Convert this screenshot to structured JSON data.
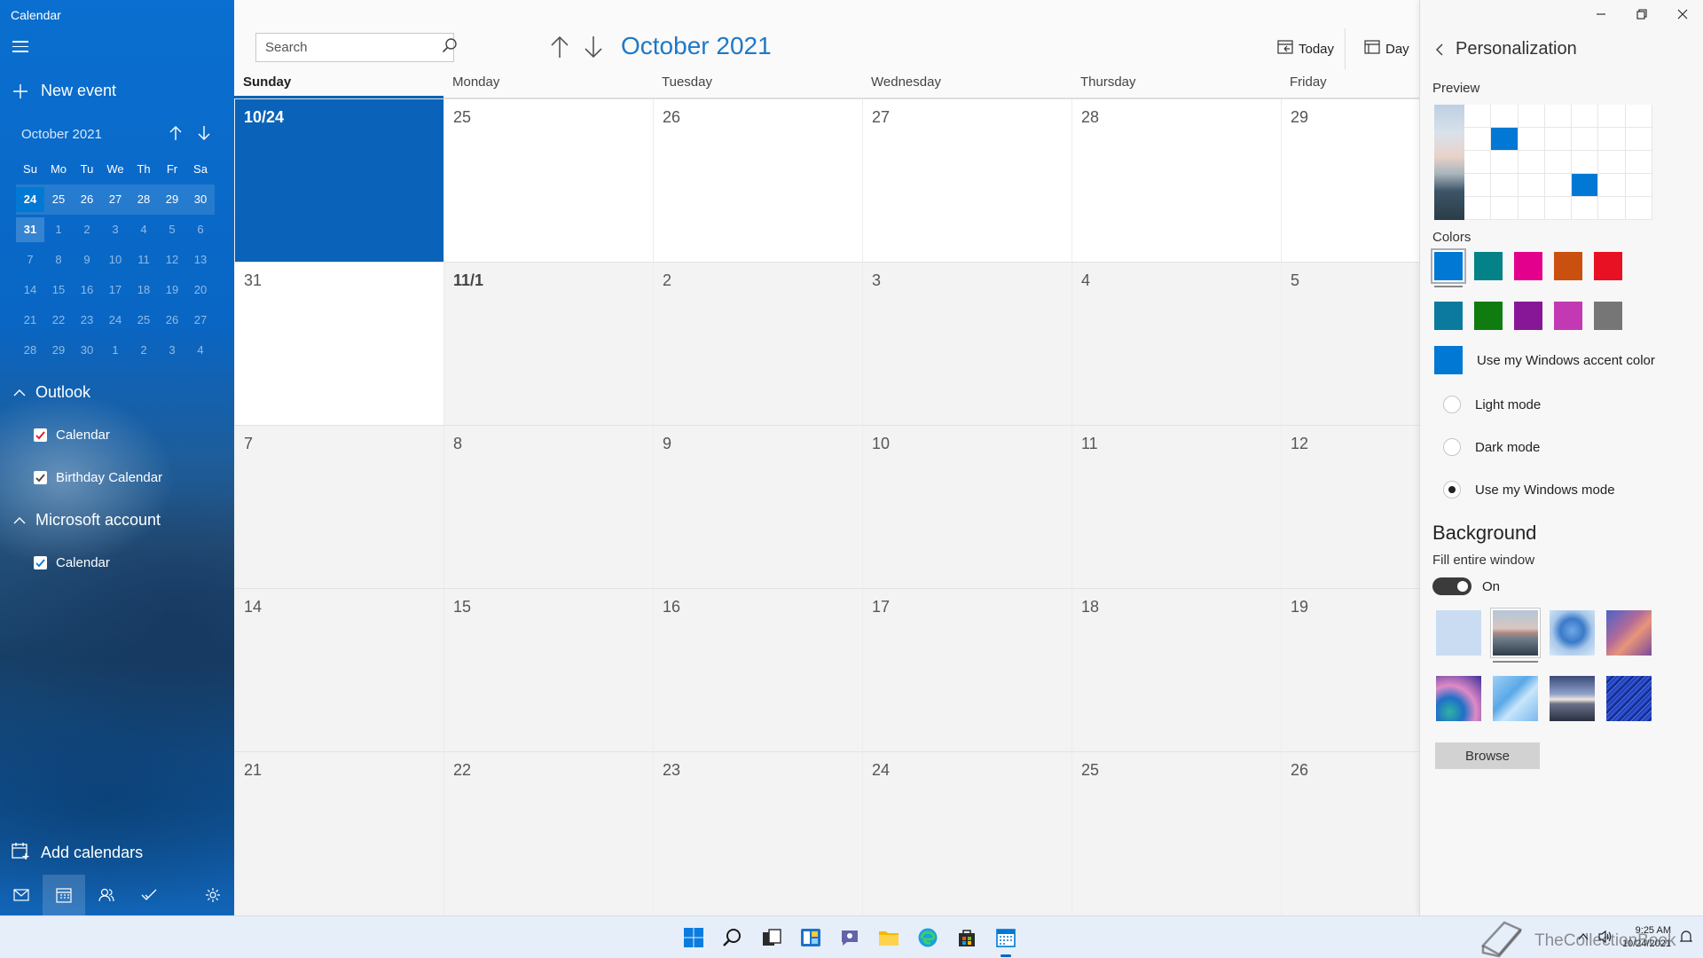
{
  "app": {
    "title": "Calendar"
  },
  "sidebar": {
    "new_event": "New event",
    "mini_month": "October 2021",
    "weekday_heads": [
      "Su",
      "Mo",
      "Tu",
      "We",
      "Th",
      "Fr",
      "Sa"
    ],
    "mini_weeks": [
      [
        "24",
        "25",
        "26",
        "27",
        "28",
        "29",
        "30"
      ],
      [
        "31",
        "1",
        "2",
        "3",
        "4",
        "5",
        "6"
      ],
      [
        "7",
        "8",
        "9",
        "10",
        "11",
        "12",
        "13"
      ],
      [
        "14",
        "15",
        "16",
        "17",
        "18",
        "19",
        "20"
      ],
      [
        "21",
        "22",
        "23",
        "24",
        "25",
        "26",
        "27"
      ],
      [
        "28",
        "29",
        "30",
        "1",
        "2",
        "3",
        "4"
      ]
    ],
    "groups": [
      {
        "name": "Outlook",
        "calendars": [
          "Calendar",
          "Birthday Calendar"
        ],
        "colors": [
          "#e81123",
          "#555555"
        ]
      },
      {
        "name": "Microsoft account",
        "calendars": [
          "Calendar"
        ],
        "colors": [
          "#0078d4"
        ]
      }
    ],
    "add_calendars": "Add calendars"
  },
  "main": {
    "search_placeholder": "Search",
    "month_title": "October 2021",
    "today_btn": "Today",
    "day_btn": "Day",
    "day_headers": [
      "Sunday",
      "Monday",
      "Tuesday",
      "Wednesday",
      "Thursday",
      "Friday"
    ],
    "weeks": [
      [
        "10/24",
        "25",
        "26",
        "27",
        "28",
        "29"
      ],
      [
        "31",
        "11/1",
        "2",
        "3",
        "4",
        "5"
      ],
      [
        "7",
        "8",
        "9",
        "10",
        "11",
        "12"
      ],
      [
        "14",
        "15",
        "16",
        "17",
        "18",
        "19"
      ],
      [
        "21",
        "22",
        "23",
        "24",
        "25",
        "26"
      ]
    ]
  },
  "panel": {
    "title": "Personalization",
    "preview_label": "Preview",
    "colors_label": "Colors",
    "colors": [
      "#0078d4",
      "#038387",
      "#e3008c",
      "#ca5010",
      "#e81123",
      "#0b7a9e",
      "#107c10",
      "#881798",
      "#c239b3",
      "#767676"
    ],
    "accent_color": "#0078d4",
    "accent_label": "Use my Windows accent color",
    "modes": [
      "Light mode",
      "Dark mode",
      "Use my Windows mode"
    ],
    "selected_mode": "Use my Windows mode",
    "background_title": "Background",
    "fill_label": "Fill entire window",
    "toggle_state": "On",
    "browse": "Browse"
  },
  "taskbar": {
    "icons": [
      "windows-start-icon",
      "search-icon",
      "task-view-icon",
      "widgets-icon",
      "chat-icon",
      "file-explorer-icon",
      "edge-icon",
      "store-icon",
      "calendar-app-icon"
    ],
    "time": "9:25 AM",
    "date": "10/24/2021"
  },
  "watermark": "TheCollectionBook"
}
